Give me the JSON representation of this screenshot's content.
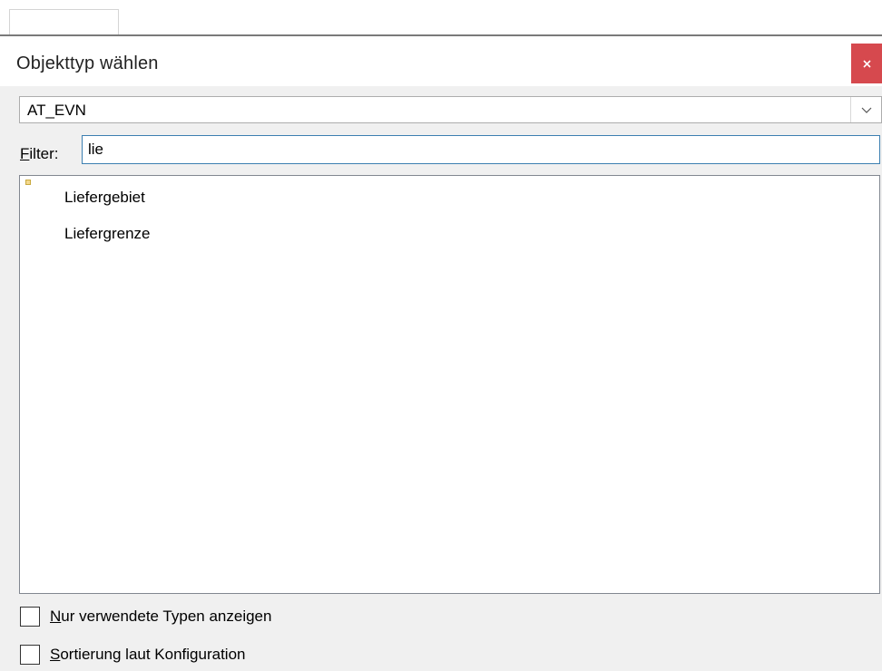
{
  "dialog": {
    "title": "Objekttyp wählen",
    "close_icon": "close-icon"
  },
  "type_select": {
    "value": "AT_EVN",
    "icon": "chevron-down-icon"
  },
  "filter": {
    "label_accesskey": "F",
    "label_rest": "ilter:",
    "value": "lie"
  },
  "type_list": {
    "items": [
      {
        "label": "Liefergebiet"
      },
      {
        "label": "Liefergrenze"
      }
    ]
  },
  "options": {
    "used_types_accesskey": "N",
    "used_types_rest": "ur verwendete Typen anzeigen",
    "sort_config_accesskey": "S",
    "sort_config_rest": "ortierung laut Konfiguration"
  },
  "colors": {
    "close_button": "#d6494e",
    "filter_border": "#3c7fb1",
    "dialog_background": "#f0f0f0"
  }
}
